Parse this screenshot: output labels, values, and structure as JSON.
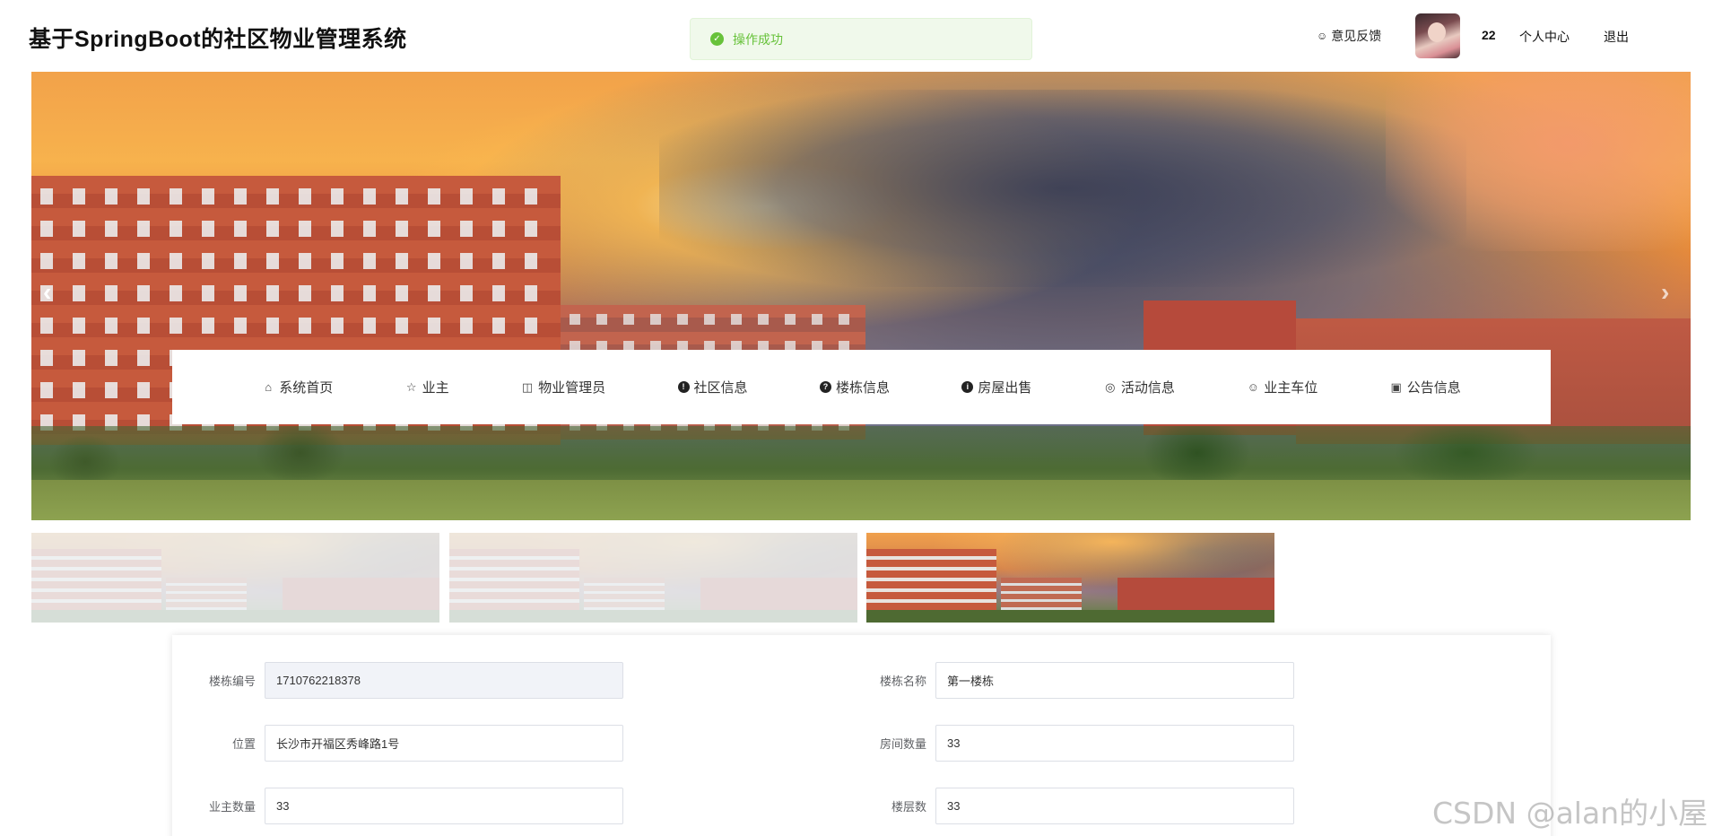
{
  "header": {
    "title": "基于SpringBoot的社区物业管理系统",
    "toast": "操作成功",
    "feedback": "意见反馈",
    "username": "22",
    "profile": "个人中心",
    "logout": "退出"
  },
  "banner": {
    "prev": "‹",
    "next": "›"
  },
  "nav": {
    "items": [
      {
        "label": "系统首页",
        "icon": "home-icon"
      },
      {
        "label": "业主",
        "icon": "star-icon"
      },
      {
        "label": "物业管理员",
        "icon": "bag-icon"
      },
      {
        "label": "社区信息",
        "icon": "exclamation-circle-icon"
      },
      {
        "label": "楼栋信息",
        "icon": "question-circle-icon"
      },
      {
        "label": "房屋出售",
        "icon": "info-circle-icon"
      },
      {
        "label": "活动信息",
        "icon": "target-icon"
      },
      {
        "label": "业主车位",
        "icon": "smile-icon"
      },
      {
        "label": "公告信息",
        "icon": "camera-icon"
      }
    ]
  },
  "form": {
    "building_no_label": "楼栋编号",
    "building_no": "1710762218378",
    "building_name_label": "楼栋名称",
    "building_name": "第一楼栋",
    "location_label": "位置",
    "location": "长沙市开福区秀峰路1号",
    "room_count_label": "房间数量",
    "room_count": "33",
    "owner_count_label": "业主数量",
    "owner_count": "33",
    "floors_label": "楼层数",
    "floors": "33"
  },
  "watermark": "CSDN @alan的小屋",
  "colors": {
    "success": "#67c23a",
    "toast_bg": "#f0f9eb"
  }
}
